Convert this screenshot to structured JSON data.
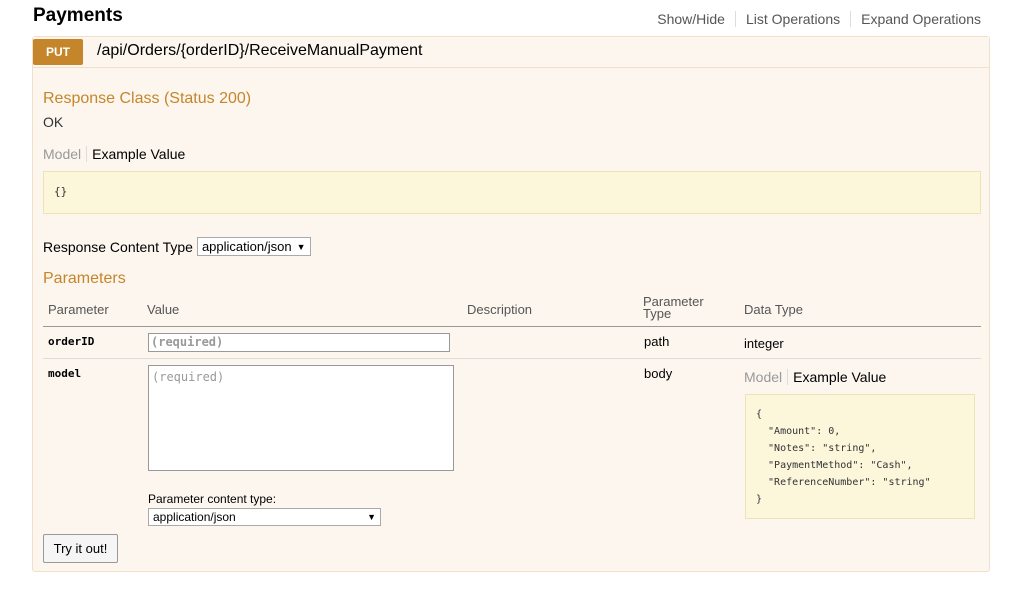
{
  "section": {
    "title": "Payments",
    "links": [
      "Show/Hide",
      "List Operations",
      "Expand Operations"
    ]
  },
  "operation": {
    "method": "PUT",
    "path": "/api/Orders/{orderID}/ReceiveManualPayment"
  },
  "response_class": {
    "title": "Response Class (Status 200)",
    "value": "OK",
    "tab_model": "Model",
    "tab_example": "Example Value",
    "sample": "{}"
  },
  "response_content_type": {
    "label": "Response Content Type",
    "selected": "application/json"
  },
  "parameters": {
    "title": "Parameters",
    "headers": {
      "parameter": "Parameter",
      "value": "Value",
      "description": "Description",
      "param_type": "Parameter Type",
      "data_type": "Data Type"
    },
    "rows": [
      {
        "name": "orderID",
        "placeholder": "(required)",
        "param_type": "path",
        "data_type": "integer"
      },
      {
        "name": "model",
        "placeholder": "(required)",
        "param_type": "body",
        "tab_model": "Model",
        "tab_example": "Example Value",
        "sample": "{\n  \"Amount\": 0,\n  \"Notes\": \"string\",\n  \"PaymentMethod\": \"Cash\",\n  \"ReferenceNumber\": \"string\"\n}",
        "content_type_label": "Parameter content type:",
        "content_type_selected": "application/json"
      }
    ]
  },
  "try_button": "Try it out!"
}
